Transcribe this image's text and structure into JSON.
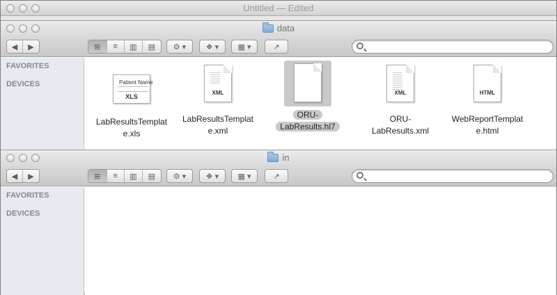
{
  "outer_window": {
    "title": "Untitled — Edited"
  },
  "windows": [
    {
      "folder_name": "data",
      "sidebar": {
        "favorites": "FAVORITES",
        "devices": "DEVICES"
      },
      "files": [
        {
          "label1": "LabResultsTemplat",
          "label2": "e.xls",
          "type": "XLS",
          "preview": "Patient Name",
          "icon": "xls-document-icon"
        },
        {
          "label1": "LabResultsTemplat",
          "label2": "e.xml",
          "type": "XML",
          "icon": "xml-document-icon"
        },
        {
          "label1": "ORU-",
          "label2": "LabResults.hl7",
          "type": "",
          "icon": "generic-document-icon",
          "selected": true
        },
        {
          "label1": "ORU-",
          "label2": "LabResults.xml",
          "type": "XML",
          "icon": "xml-document-icon"
        },
        {
          "label1": "WebReportTemplat",
          "label2": "e.html",
          "type": "HTML",
          "icon": "html-document-icon"
        }
      ]
    },
    {
      "folder_name": "in",
      "sidebar": {
        "favorites": "FAVORITES",
        "devices": "DEVICES"
      },
      "files": []
    }
  ],
  "toolbar": {
    "back_icon": "◀",
    "forward_icon": "▶",
    "view_icons": [
      "⊞",
      "≡",
      "▥",
      "▤"
    ],
    "action_icon": "⚙ ▾",
    "dropbox_icon": "❖ ▾",
    "arrange_icon": "▦ ▾",
    "share_icon": "↗",
    "search_placeholder": ""
  }
}
